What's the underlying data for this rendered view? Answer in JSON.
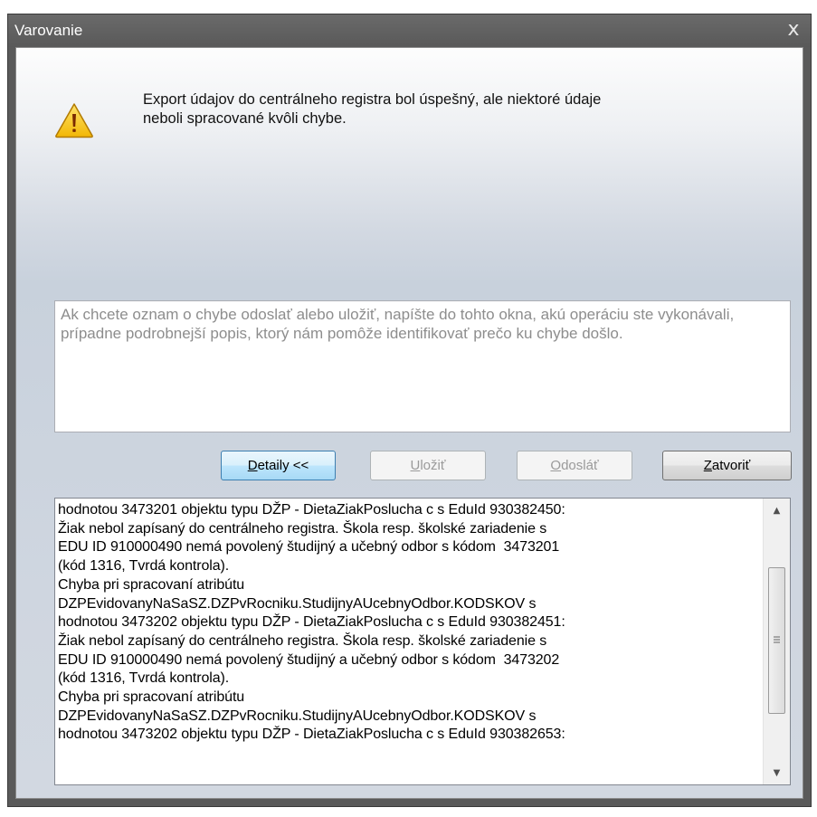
{
  "window": {
    "title": "Varovanie",
    "close_glyph": "x"
  },
  "message": {
    "icon": "warning-icon",
    "text": "Export údajov do centrálneho registra bol úspešný, ale niektoré údaje\nneboli spracované kvôli chybe."
  },
  "comment": {
    "value": "",
    "placeholder": "Ak chcete oznam o chybe odoslať alebo uložiť, napíšte do tohto okna, akú operáciu ste vykonávali, prípadne podrobnejší popis, ktorý nám pomôže identifikovať prečo ku chybe došlo."
  },
  "buttons": {
    "details": {
      "label": "etaily <<",
      "mnemonic": "D",
      "state": "default"
    },
    "save": {
      "label": "ložiť",
      "mnemonic": "U",
      "state": "disabled"
    },
    "send": {
      "label": "dosláť",
      "mnemonic": "O",
      "state": "disabled"
    },
    "close": {
      "label": "atvoriť",
      "mnemonic": "Z",
      "state": "enabled"
    }
  },
  "details": {
    "text": "hodnotou 3473201 objektu typu DŽP - DietaZiakPoslucha c s EduId 930382450:\nŽiak nebol zapísaný do centrálneho registra. Škola resp. školské zariadenie s\nEDU ID 910000490 nemá povolený študijný a učebný odbor s kódom  3473201\n(kód 1316, Tvrdá kontrola).\nChyba pri spracovaní atribútu\nDZPEvidovanyNaSaSZ.DZPvRocniku.StudijnyAUcebnyOdbor.KODSKOV s\nhodnotou 3473202 objektu typu DŽP - DietaZiakPoslucha c s EduId 930382451:\nŽiak nebol zapísaný do centrálneho registra. Škola resp. školské zariadenie s\nEDU ID 910000490 nemá povolený študijný a učebný odbor s kódom  3473202\n(kód 1316, Tvrdá kontrola).\nChyba pri spracovaní atribútu\nDZPEvidovanyNaSaSZ.DZPvRocniku.StudijnyAUcebnyOdbor.KODSKOV s\nhodnotou 3473202 objektu typu DŽP - DietaZiakPoslucha c s EduId 930382653:",
    "scroll_up_glyph": "▲",
    "scroll_down_glyph": "▼"
  },
  "colors": {
    "titlebar": "#5a5a5a",
    "warning_fill": "#f5c518",
    "warning_border": "#b27a00",
    "default_button_border": "#3c7fb1"
  }
}
